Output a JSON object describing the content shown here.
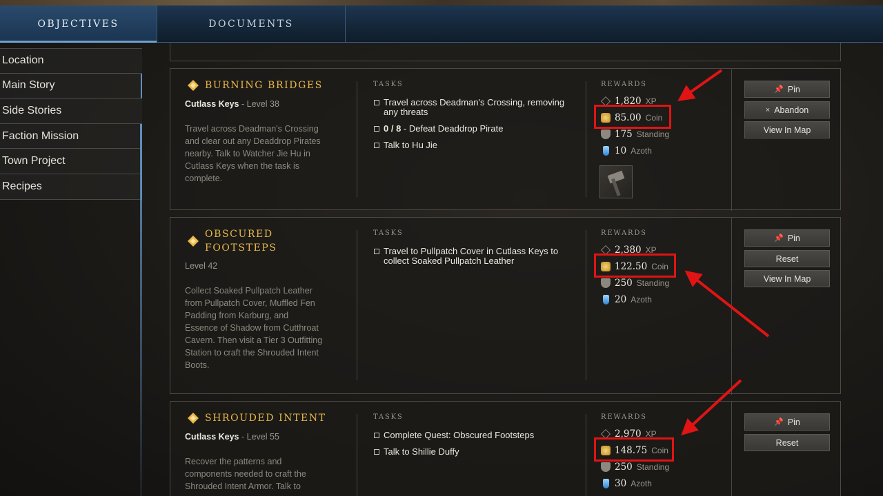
{
  "tabs": [
    {
      "label": "OBJECTIVES",
      "active": true
    },
    {
      "label": "DOCUMENTS",
      "active": false
    }
  ],
  "sidebar": {
    "items": [
      {
        "label": "Location"
      },
      {
        "label": "Main Story"
      },
      {
        "label": "Side Stories"
      },
      {
        "label": "Faction Mission"
      },
      {
        "label": "Town Project"
      },
      {
        "label": "Recipes"
      }
    ]
  },
  "headers": {
    "tasks": "TASKS",
    "rewards": "REWARDS"
  },
  "quests": [
    {
      "title": "BURNING BRIDGES",
      "location": "Cutlass Keys",
      "level": "- Level 38",
      "description": "Travel across Deadman's Crossing and clear out any Deaddrop Pirates nearby. Talk to Watcher Jie Hu in Cutlass Keys when the task is complete.",
      "tasks": [
        {
          "text": "Travel across Deadman's Crossing, removing any threats"
        },
        {
          "progress": "0 / 8",
          "text": " - Defeat Deaddrop Pirate"
        },
        {
          "text": "Talk to Hu Jie"
        }
      ],
      "rewards": {
        "xp": "1,820",
        "xp_label": "XP",
        "coin": "85.00",
        "coin_label": "Coin",
        "standing": "175",
        "standing_label": "Standing",
        "azoth": "10",
        "azoth_label": "Azoth"
      },
      "item_icon": "hammer-item-icon",
      "actions": [
        {
          "glyph": "📌",
          "label": "Pin"
        },
        {
          "glyph": "×",
          "label": "Abandon"
        },
        {
          "glyph": "",
          "label": "View In Map"
        }
      ]
    },
    {
      "title_line1": "OBSCURED",
      "title_line2": "FOOTSTEPS",
      "level": "Level 42",
      "description": "Collect Soaked Pullpatch Leather from Pullpatch Cover, Muffled Fen Padding from Karburg, and Essence of Shadow from Cutthroat Cavern. Then visit a Tier 3 Outfitting Station to craft the Shrouded Intent Boots.",
      "tasks": [
        {
          "text": "Travel to Pullpatch Cover in Cutlass Keys to collect Soaked Pullpatch Leather"
        }
      ],
      "rewards": {
        "xp": "2,380",
        "xp_label": "XP",
        "coin": "122.50",
        "coin_label": "Coin",
        "standing": "250",
        "standing_label": "Standing",
        "azoth": "20",
        "azoth_label": "Azoth"
      },
      "actions": [
        {
          "glyph": "📌",
          "label": "Pin"
        },
        {
          "glyph": "",
          "label": "Reset"
        },
        {
          "glyph": "",
          "label": "View In Map"
        }
      ]
    },
    {
      "title": "SHROUDED INTENT",
      "location": "Cutlass Keys",
      "level": "- Level 55",
      "description": "Recover the patterns and components needed to craft the Shrouded Intent Armor. Talk to",
      "tasks": [
        {
          "text": "Complete Quest: Obscured Footsteps"
        },
        {
          "text": "Talk to Shillie Duffy"
        }
      ],
      "rewards": {
        "xp": "2,970",
        "xp_label": "XP",
        "coin": "148.75",
        "coin_label": "Coin",
        "standing": "250",
        "standing_label": "Standing",
        "azoth": "30",
        "azoth_label": "Azoth"
      },
      "actions": [
        {
          "glyph": "📌",
          "label": "Pin"
        },
        {
          "glyph": "",
          "label": "Reset"
        }
      ]
    }
  ],
  "colors": {
    "accent_gold": "#e8b84a",
    "highlight_red": "#e01414",
    "tab_blue": "#1d3550"
  }
}
